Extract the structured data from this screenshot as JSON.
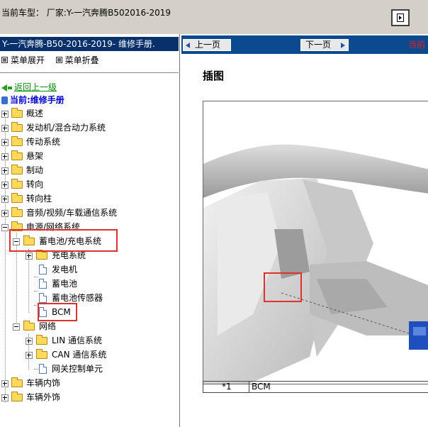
{
  "top_bar": {
    "text": "当前车型：  厂家:Y-一汽奔腾B502016-2019"
  },
  "left_panel": {
    "manual_title": "Y-一汽奔腾-B50-2016-2019- 维修手册.",
    "expand_label": "菜单展开",
    "collapse_label": "菜单折叠",
    "back_label": "返回上一级",
    "current_label": "当前:维修手册",
    "tree": [
      {
        "label": "概述"
      },
      {
        "label": "发动机/混合动力系统"
      },
      {
        "label": "传动系统"
      },
      {
        "label": "悬架"
      },
      {
        "label": "制动"
      },
      {
        "label": "转向"
      },
      {
        "label": "转向柱"
      },
      {
        "label": "音频/视频/车载通信系统"
      },
      {
        "label": "电源/网络系统"
      },
      {
        "label": "蓄电池/充电系统"
      },
      {
        "label": "充电系统"
      },
      {
        "label": "发电机"
      },
      {
        "label": "蓄电池"
      },
      {
        "label": "蓄电池传感器"
      },
      {
        "label": "BCM"
      },
      {
        "label": "网络"
      },
      {
        "label": "LIN 通信系统"
      },
      {
        "label": "CAN 通信系统"
      },
      {
        "label": "网关控制单元"
      },
      {
        "label": "车辆内饰"
      },
      {
        "label": "车辆外饰"
      }
    ]
  },
  "right_panel": {
    "prev_label": "上一页",
    "next_label": "下一页",
    "current_page_label": "当前",
    "section_title": "插图",
    "caption": {
      "num": "*1",
      "text": "BCM"
    }
  },
  "colors": {
    "title_bar_bg": "#d4d0c8",
    "manual_title_bg": "#08306b",
    "toolbar_bg": "#0b4a8f",
    "highlight": "#e03030",
    "back_link": "#0a8a0a",
    "current_link": "#0000cc"
  }
}
